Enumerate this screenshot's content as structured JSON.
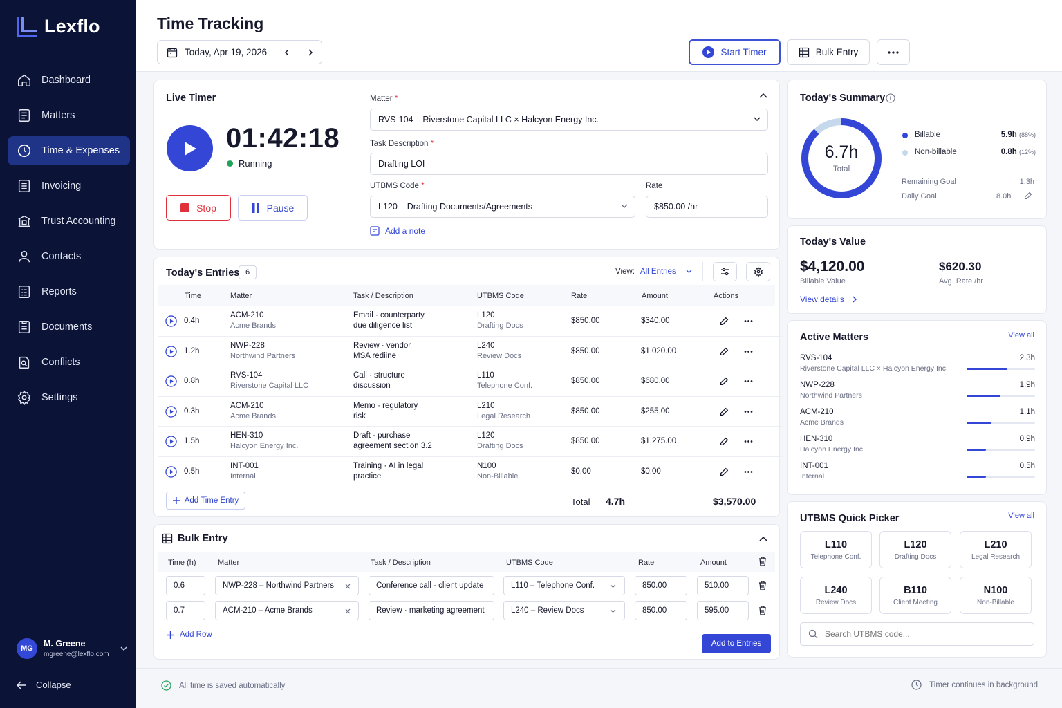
{
  "app": {
    "name": "Lexflo"
  },
  "sidebar": {
    "items": [
      {
        "label": "Dashboard"
      },
      {
        "label": "Matters"
      },
      {
        "label": "Time & Expenses"
      },
      {
        "label": "Invoicing"
      },
      {
        "label": "Trust Accounting"
      },
      {
        "label": "Contacts"
      },
      {
        "label": "Reports"
      },
      {
        "label": "Documents"
      },
      {
        "label": "Conflicts"
      },
      {
        "label": "Settings"
      }
    ],
    "user": {
      "initials": "MG",
      "name": "M. Greene",
      "email": "mgreene@lexflo.com"
    },
    "collapse_label": "Collapse"
  },
  "header": {
    "title": "Time Tracking",
    "date": "Today, Apr 19, 2026",
    "start_timer": "Start Timer",
    "bulk_entry": "Bulk Entry"
  },
  "live_timer": {
    "title": "Live Timer",
    "time": "01:42:18",
    "status": "Running",
    "stop": "Stop",
    "pause": "Pause",
    "matter_label": "Matter",
    "matter_value": "RVS-104 – Riverstone Capital LLC × Halcyon Energy Inc.",
    "task_label": "Task Description",
    "task_value": "Drafting LOI",
    "utbms_label": "UTBMS Code",
    "utbms_value": "L120 – Drafting Documents/Agreements",
    "rate_label": "Rate",
    "rate_value": "$850.00 /hr",
    "add_note": "Add a note"
  },
  "entries": {
    "title": "Today's Entries",
    "count": "6",
    "view_label": "View:",
    "view_value": "All Entries",
    "columns": [
      "Time",
      "Matter",
      "Task / Description",
      "UTBMS Code",
      "Rate",
      "Amount",
      "Actions"
    ],
    "rows": [
      {
        "time": "0.4h",
        "matter": "ACM-210",
        "client": "Acme Brands",
        "task1": "Email · counterparty",
        "task2": "due diligence list",
        "code": "L120",
        "code_desc": "Drafting Docs",
        "rate": "$850.00",
        "amount": "$340.00"
      },
      {
        "time": "1.2h",
        "matter": "NWP-228",
        "client": "Northwind Partners",
        "task1": "Review · vendor",
        "task2": "MSA rediine",
        "code": "L240",
        "code_desc": "Review Docs",
        "rate": "$850.00",
        "amount": "$1,020.00"
      },
      {
        "time": "0.8h",
        "matter": "RVS-104",
        "client": "Riverstone Capital LLC",
        "task1": "Call · structure",
        "task2": "discussion",
        "code": "L110",
        "code_desc": "Telephone Conf.",
        "rate": "$850.00",
        "amount": "$680.00"
      },
      {
        "time": "0.3h",
        "matter": "ACM-210",
        "client": "Acme Brands",
        "task1": "Memo · regulatory",
        "task2": "risk",
        "code": "L210",
        "code_desc": "Legal Research",
        "rate": "$850.00",
        "amount": "$255.00"
      },
      {
        "time": "1.5h",
        "matter": "HEN-310",
        "client": "Halcyon Energy Inc.",
        "task1": "Draft · purchase",
        "task2": "agreement section 3.2",
        "code": "L120",
        "code_desc": "Drafting Docs",
        "rate": "$850.00",
        "amount": "$1,275.00"
      },
      {
        "time": "0.5h",
        "matter": "INT-001",
        "client": "Internal",
        "task1": "Training · AI in legal",
        "task2": "practice",
        "code": "N100",
        "code_desc": "Non-Billable",
        "rate": "$0.00",
        "amount": "$0.00"
      }
    ],
    "add_entry": "Add Time Entry",
    "total_label": "Total",
    "total_hours": "4.7h",
    "total_amount": "$3,570.00"
  },
  "bulk": {
    "title": "Bulk Entry",
    "columns": [
      "Time (h)",
      "Matter",
      "Task / Description",
      "UTBMS Code",
      "Rate",
      "Amount"
    ],
    "rows": [
      {
        "time": "0.6",
        "matter": "NWP-228 – Northwind Partners",
        "task": "Conference call · client update",
        "code": "L110 – Telephone Conf.",
        "rate": "850.00",
        "amount": "510.00"
      },
      {
        "time": "0.7",
        "matter": "ACM-210 – Acme Brands",
        "task": "Review · marketing agreement",
        "code": "L240 – Review Docs",
        "rate": "850.00",
        "amount": "595.00"
      }
    ],
    "add_row": "Add Row",
    "submit": "Add to Entries"
  },
  "summary": {
    "title": "Today's Summary",
    "total": "6.7h",
    "total_label": "Total",
    "billable_fraction": 0.88,
    "billable_label": "Billable",
    "billable_value": "5.9h",
    "billable_pct": "(88%)",
    "nonbillable_label": "Non-billable",
    "nonbillable_value": "0.8h",
    "nonbillable_pct": "(12%)",
    "remaining_label": "Remaining Goal",
    "remaining_value": "1.3h",
    "daily_label": "Daily Goal",
    "daily_value": "8.0h"
  },
  "value": {
    "title": "Today's Value",
    "billable_value": "$4,120.00",
    "billable_label": "Billable Value",
    "avg_rate": "$620.30",
    "avg_label": "Avg. Rate /hr",
    "details": "View details"
  },
  "active_matters": {
    "title": "Active Matters",
    "view_all": "View all",
    "items": [
      {
        "code": "RVS-104",
        "name": "Riverstone Capital LLC × Halcyon Energy Inc.",
        "hours": "2.3h",
        "fraction": 0.6
      },
      {
        "code": "NWP-228",
        "name": "Northwind Partners",
        "hours": "1.9h",
        "fraction": 0.49
      },
      {
        "code": "ACM-210",
        "name": "Acme Brands",
        "hours": "1.1h",
        "fraction": 0.36
      },
      {
        "code": "HEN-310",
        "name": "Halcyon Energy Inc.",
        "hours": "0.9h",
        "fraction": 0.28
      },
      {
        "code": "INT-001",
        "name": "Internal",
        "hours": "0.5h",
        "fraction": 0.28
      }
    ]
  },
  "quick_picker": {
    "title": "UTBMS Quick Picker",
    "view_all": "View all",
    "codes": [
      {
        "code": "L110",
        "desc": "Telephone Conf."
      },
      {
        "code": "L120",
        "desc": "Drafting Docs"
      },
      {
        "code": "L210",
        "desc": "Legal Research"
      },
      {
        "code": "L240",
        "desc": "Review Docs"
      },
      {
        "code": "B110",
        "desc": "Client Meeting"
      },
      {
        "code": "N100",
        "desc": "Non-Billable"
      }
    ],
    "search_placeholder": "Search UTBMS code..."
  },
  "footer": {
    "saved": "All time is saved automatically",
    "background": "Timer continues in background"
  },
  "colors": {
    "accent": "#3346d6",
    "sidebar": "#0b1437",
    "stop": "#e0303a",
    "running": "#22a35a"
  }
}
